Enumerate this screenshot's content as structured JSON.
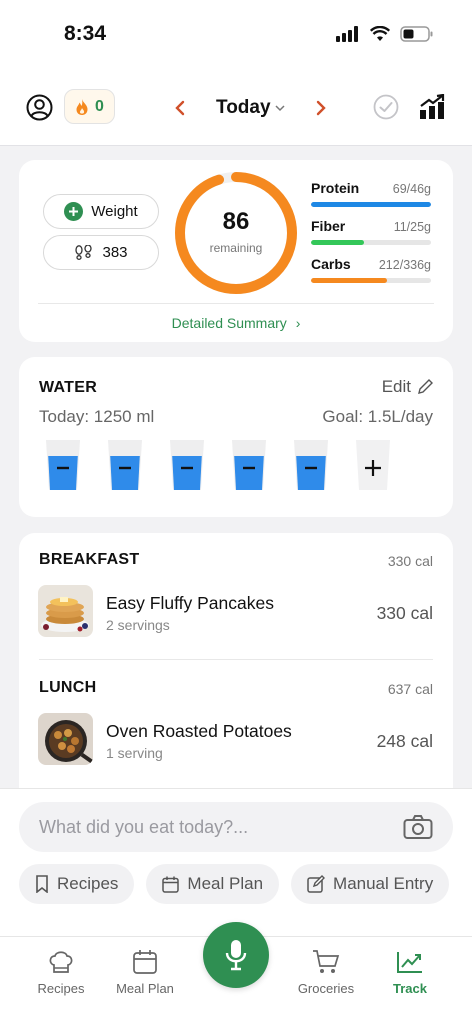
{
  "status": {
    "time": "8:34"
  },
  "header": {
    "streak_count": "0",
    "date_label": "Today"
  },
  "summary": {
    "weight_label": "Weight",
    "steps": "383",
    "calories_value": "86",
    "calories_label": "remaining",
    "calories_progress": 0.95,
    "macros": [
      {
        "name": "Protein",
        "value": "69/46g",
        "fraction": 1.0,
        "color": "#1e88e5"
      },
      {
        "name": "Fiber",
        "value": "11/25g",
        "fraction": 0.44,
        "color": "#34c759"
      },
      {
        "name": "Carbs",
        "value": "212/336g",
        "fraction": 0.63,
        "color": "#f5891f"
      }
    ],
    "detailed_link": "Detailed Summary"
  },
  "water": {
    "title": "WATER",
    "edit_label": "Edit",
    "today_text": "Today: 1250 ml",
    "goal_text": "Goal: 1.5L/day",
    "filled_glasses": 5
  },
  "meals": [
    {
      "name": "BREAKFAST",
      "total": "330 cal",
      "items": [
        {
          "name": "Easy Fluffy Pancakes",
          "servings": "2 servings",
          "cal": "330 cal"
        }
      ]
    },
    {
      "name": "LUNCH",
      "total": "637 cal",
      "items": [
        {
          "name": "Oven Roasted Potatoes",
          "servings": "1 serving",
          "cal": "248 cal"
        }
      ]
    }
  ],
  "input": {
    "placeholder": "What did you eat today?..."
  },
  "chips": [
    {
      "label": "Recipes"
    },
    {
      "label": "Meal Plan"
    },
    {
      "label": "Manual Entry"
    }
  ],
  "tabs": [
    {
      "label": "Recipes"
    },
    {
      "label": "Meal Plan"
    },
    {
      "label": "Groceries"
    },
    {
      "label": "Track"
    }
  ],
  "colors": {
    "accent": "#2f8f52",
    "ring": "#f5891f",
    "water": "#2f8bea"
  }
}
